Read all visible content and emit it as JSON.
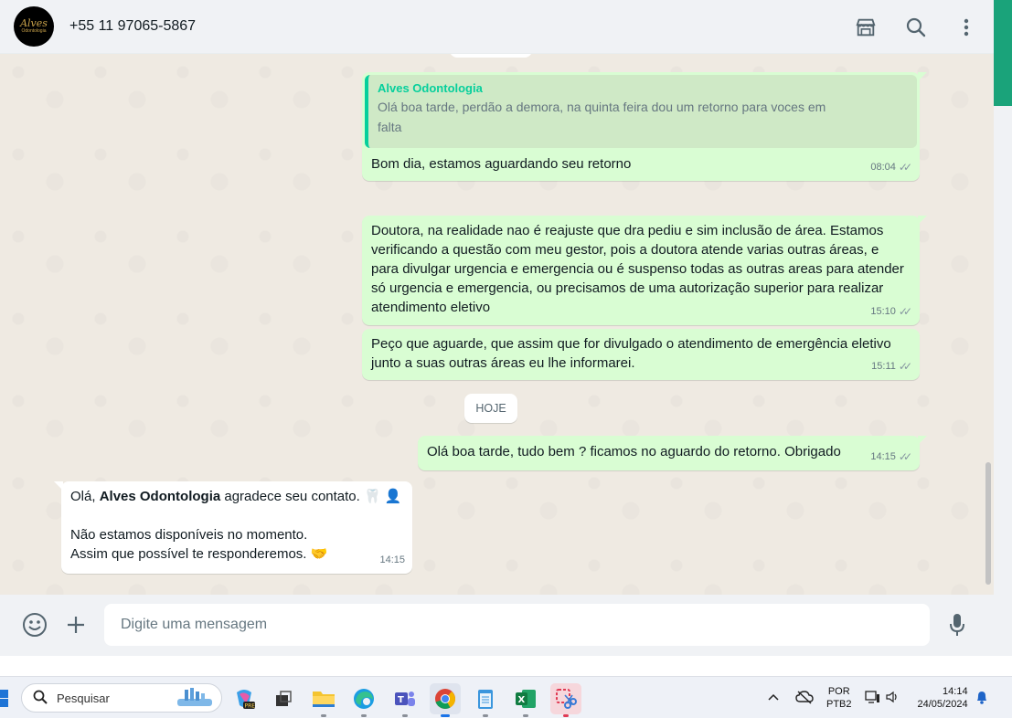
{
  "header": {
    "contact_name": "+55 11 97065-5867",
    "avatar_logo": "Alves",
    "avatar_sub": "Odontologia",
    "icons": [
      "store-icon",
      "search-icon",
      "kebab-menu-icon"
    ]
  },
  "messages": [
    {
      "quote_author": "Alves Odontologia",
      "quote_text": "Olá boa tarde, perdão a demora, na quinta feira dou um retorno para voces em falta",
      "text": "Bom dia, estamos aguardando seu retorno",
      "time": "08:04"
    },
    {
      "text": "Doutora, na realidade nao é reajuste que dra pediu e sim inclusão de área. Estamos verificando a questão com meu gestor, pois a doutora atende varias outras áreas, e para divulgar urgencia e emergencia ou é suspenso todas as outras areas para atender só urgencia e emergencia, ou precisamos de uma autorização superior para realizar atendimento eletivo",
      "time": "15:10"
    },
    {
      "text": "Peço que aguarde, que assim que for divulgado o atendimento de emergência eletivo junto a suas outras áreas eu lhe informarei.",
      "time": "15:11"
    },
    {
      "text": "Olá boa tarde, tudo bem ? ficamos no aguardo do retorno. Obrigado",
      "time": "14:15"
    }
  ],
  "date_chip": "HOJE",
  "incoming": {
    "greeting_prefix": "Olá, ",
    "business_name": "Alves Odontologia",
    "greeting_suffix": " agradece seu contato.",
    "line2": "Não estamos disponíveis no momento.",
    "line3": "Assim que possível te responderemos.",
    "time": "14:15"
  },
  "composer": {
    "placeholder": "Digite uma mensagem"
  },
  "taskbar": {
    "search_label": "Pesquisar",
    "lang_top": "POR",
    "lang_bottom": "PTB2",
    "clock_time": "14:14",
    "clock_date": "24/05/2024"
  },
  "colors": {
    "outgoing_bubble": "#d9fdd3",
    "incoming_bubble": "#ffffff",
    "accent": "#06cf9c",
    "chat_background": "#efeae2"
  }
}
